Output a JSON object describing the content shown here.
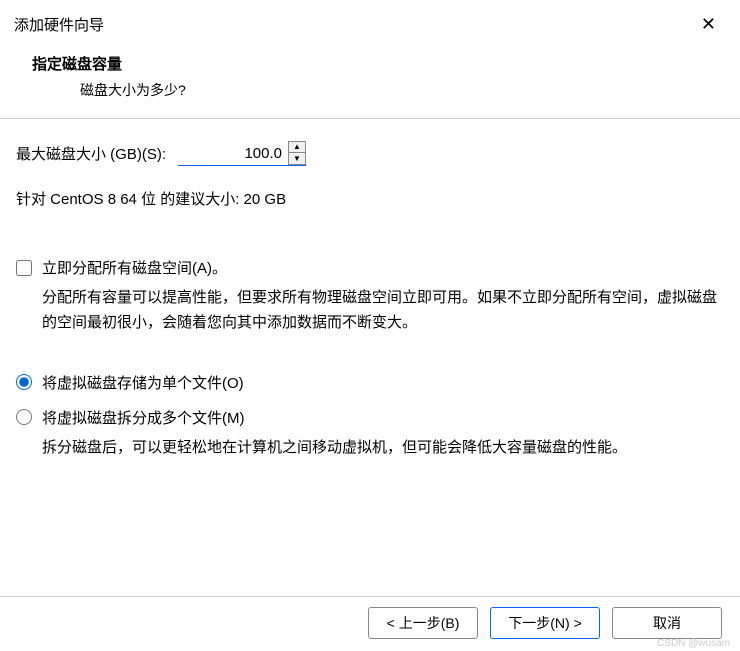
{
  "window": {
    "title": "添加硬件向导"
  },
  "header": {
    "title": "指定磁盘容量",
    "subtitle": "磁盘大小为多少?"
  },
  "diskSize": {
    "label": "最大磁盘大小 (GB)(S):",
    "value": "100.0"
  },
  "recommendation": "针对 CentOS 8 64 位 的建议大小: 20 GB",
  "allocateNow": {
    "label": "立即分配所有磁盘空间(A)。",
    "checked": false,
    "description": "分配所有容量可以提高性能，但要求所有物理磁盘空间立即可用。如果不立即分配所有空间，虚拟磁盘的空间最初很小，会随着您向其中添加数据而不断变大。"
  },
  "storage": {
    "single": {
      "label": "将虚拟磁盘存储为单个文件(O)"
    },
    "split": {
      "label": "将虚拟磁盘拆分成多个文件(M)",
      "description": "拆分磁盘后，可以更轻松地在计算机之间移动虚拟机，但可能会降低大容量磁盘的性能。"
    },
    "selected": "single"
  },
  "buttons": {
    "back": "< 上一步(B)",
    "next": "下一步(N) >",
    "cancel": "取消"
  },
  "watermark": "CSDN @wusam"
}
